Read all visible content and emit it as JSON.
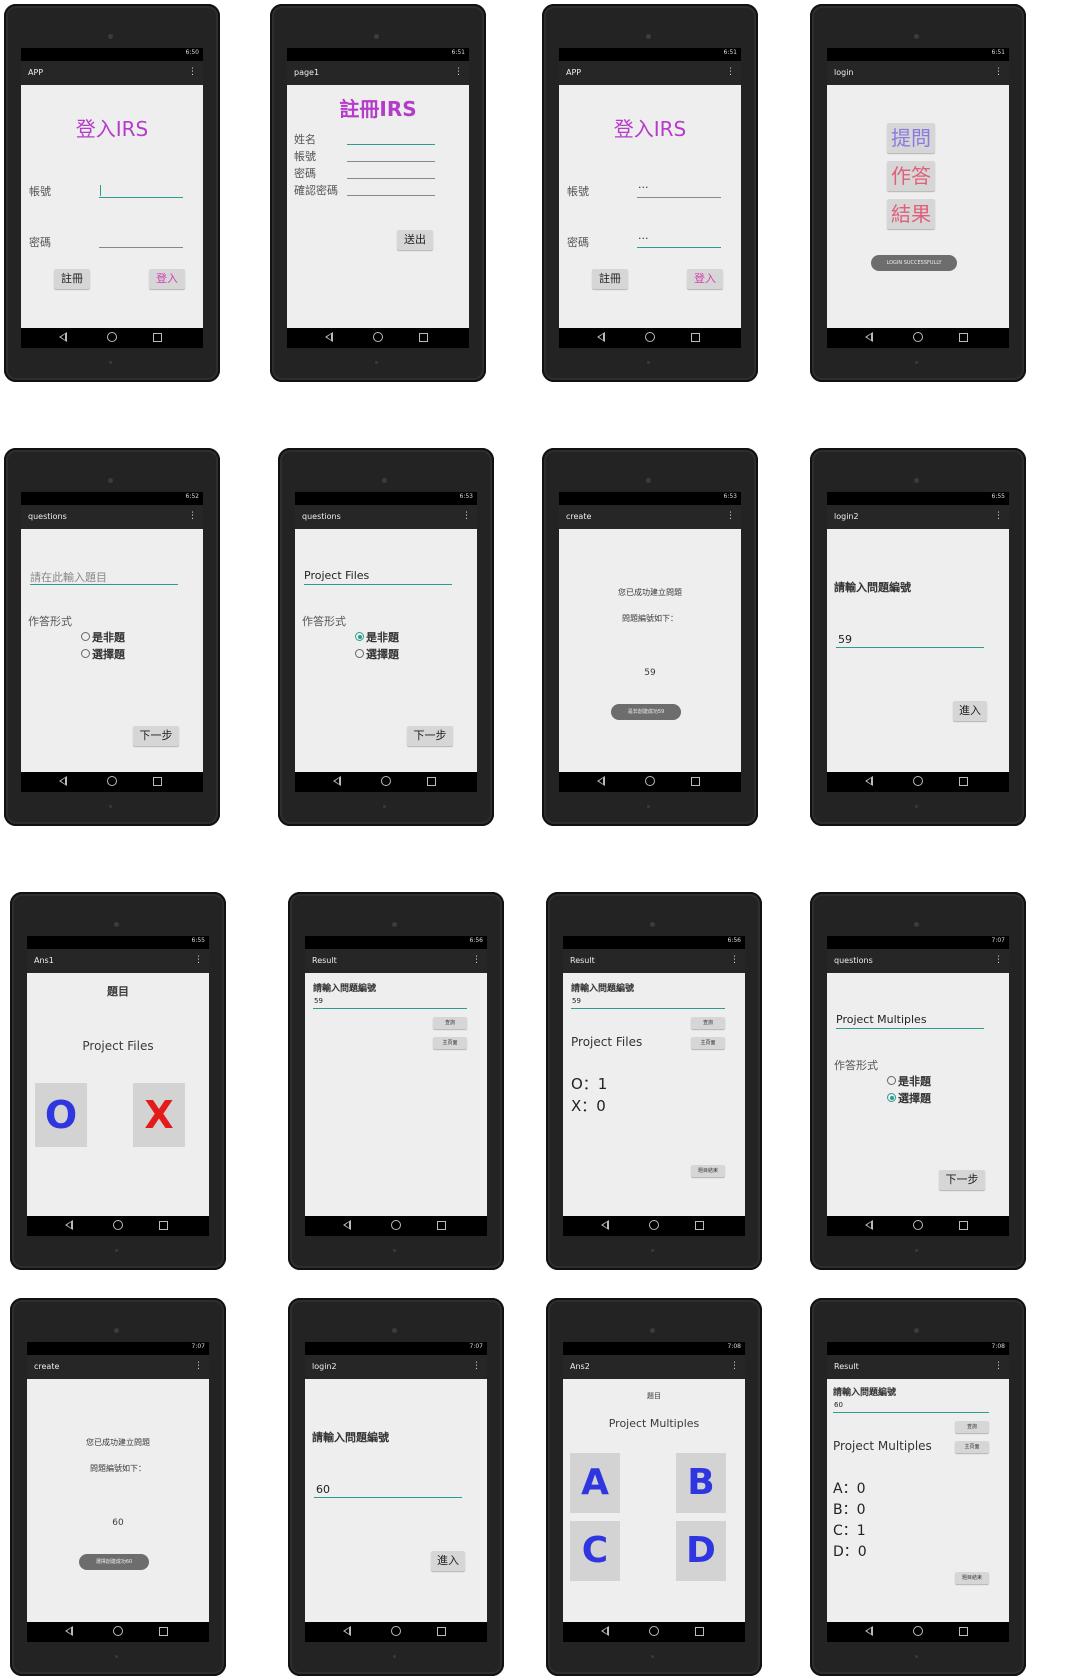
{
  "status_times": [
    "6:50",
    "6:51",
    "6:51",
    "6:51",
    "6:52",
    "6:53",
    "6:53",
    "6:55",
    "6:55",
    "6:56",
    "6:56",
    "7:07",
    "7:07",
    "7:07",
    "7:08",
    "7:08"
  ],
  "screens": {
    "s1": {
      "title": "APP",
      "heading": "登入IRS",
      "account_label": "帳號",
      "password_label": "密碼",
      "register_btn": "註冊",
      "login_btn": "登入"
    },
    "s2": {
      "title": "page1",
      "heading": "註冊IRS",
      "name_label": "姓名",
      "account_label": "帳號",
      "password_label": "密碼",
      "confirm_label": "確認密碼",
      "submit_btn": "送出"
    },
    "s3": {
      "title": "APP",
      "heading": "登入IRS",
      "account_label": "帳號",
      "account_value": "···",
      "password_label": "密碼",
      "password_value": "···",
      "register_btn": "註冊",
      "login_btn": "登入"
    },
    "s4": {
      "title": "login",
      "ask_btn": "提問",
      "answer_btn": "作答",
      "result_btn": "結果",
      "toast": "LOGIN SUCCESSFULLY"
    },
    "s5": {
      "title": "questions",
      "input_placeholder": "請在此輸入題目",
      "form_label": "作答形式",
      "opt_tf": "是非題",
      "opt_mc": "選擇題",
      "next_btn": "下一步"
    },
    "s6": {
      "title": "questions",
      "input_value": "Project Files",
      "form_label": "作答形式",
      "opt_tf": "是非題",
      "opt_mc": "選擇題",
      "next_btn": "下一步"
    },
    "s7": {
      "title": "create",
      "line1": "您已成功建立問題",
      "line2": "問題編號如下：",
      "number": "59",
      "toast": "是非創建成功59"
    },
    "s8": {
      "title": "login2",
      "prompt": "請輸入問題編號",
      "input_value": "59",
      "enter_btn": "進入"
    },
    "s9": {
      "title": "Ans1",
      "heading": "題目",
      "question": "Project Files",
      "btn_o": "O",
      "btn_x": "X"
    },
    "s10": {
      "title": "Result",
      "prompt": "請輸入問題編號",
      "input_value": "59",
      "query_btn": "查詢",
      "home_btn": "主頁面"
    },
    "s11": {
      "title": "Result",
      "prompt": "請輸入問題編號",
      "input_value": "59",
      "query_btn": "查詢",
      "home_btn": "主頁面",
      "question": "Project Files",
      "o_count": "O：1",
      "x_count": "X：0",
      "end_btn": "題目結束"
    },
    "s12": {
      "title": "questions",
      "input_value": "Project Multiples",
      "form_label": "作答形式",
      "opt_tf": "是非題",
      "opt_mc": "選擇題",
      "next_btn": "下一步"
    },
    "s13": {
      "title": "create",
      "line1": "您已成功建立問題",
      "line2": "問題編號如下：",
      "number": "60",
      "toast": "選擇創建成功60"
    },
    "s14": {
      "title": "login2",
      "prompt": "請輸入問題編號",
      "input_value": "60",
      "enter_btn": "進入"
    },
    "s15": {
      "title": "Ans2",
      "heading": "題目",
      "question": "Project Multiples",
      "btn_a": "A",
      "btn_b": "B",
      "btn_c": "C",
      "btn_d": "D"
    },
    "s16": {
      "title": "Result",
      "prompt": "請輸入問題編號",
      "input_value": "60",
      "query_btn": "查詢",
      "home_btn": "主頁面",
      "question": "Project Multiples",
      "a_count": "A：0",
      "b_count": "B：0",
      "c_count": "C：1",
      "d_count": "D：0",
      "end_btn": "題目結束"
    }
  },
  "colors": {
    "accent_teal": "#2a9d8f",
    "title_purple": "#b43cc9",
    "btn_pink": "#d23fb0",
    "ask_color": "#8a7be0",
    "answer_color": "#e0607a",
    "letter_blue": "#2f36e0",
    "x_red": "#e41b1b"
  }
}
